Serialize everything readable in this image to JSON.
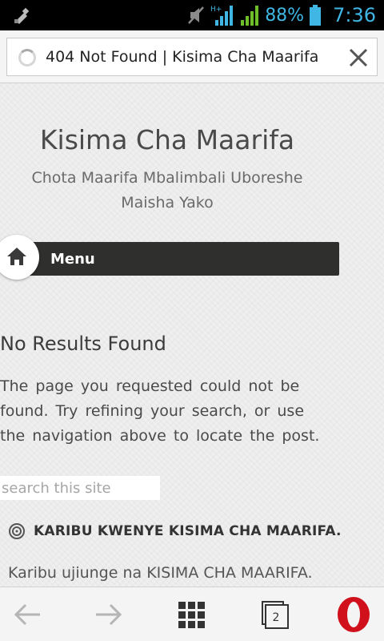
{
  "status_bar": {
    "network": "H+",
    "battery": "88%",
    "time": "7:36"
  },
  "address_bar": {
    "title": "404 Not Found | Kisima Cha Maarifa"
  },
  "site": {
    "title": "Kisima Cha Maarifa",
    "tagline": "Chota Maarifa Mbalimbali Uboreshe Maisha Yako",
    "menu_label": "Menu"
  },
  "content": {
    "heading": "No Results Found",
    "body": "The page you requested could not be found. Try refining your search, or use the navigation above to locate the post.",
    "search_placeholder": "search this site",
    "widget_title": "KARIBU KWENYE KISIMA CHA MAARIFA.",
    "widget_body": "Karibu ujiunge na KISIMA CHA MAARIFA."
  },
  "toolbar": {
    "tab_count": "2"
  },
  "colors": {
    "status_accent": "#3fb6e3",
    "menu_bar": "#2f302d",
    "opera_red": "#d0101b"
  },
  "icons": [
    "usb-icon",
    "mute-icon",
    "signal-icon",
    "battery-icon",
    "loading-icon",
    "clear-icon",
    "home-icon",
    "target-icon",
    "back-icon",
    "forward-icon",
    "speed-dial-icon",
    "tabs-icon",
    "opera-icon"
  ]
}
